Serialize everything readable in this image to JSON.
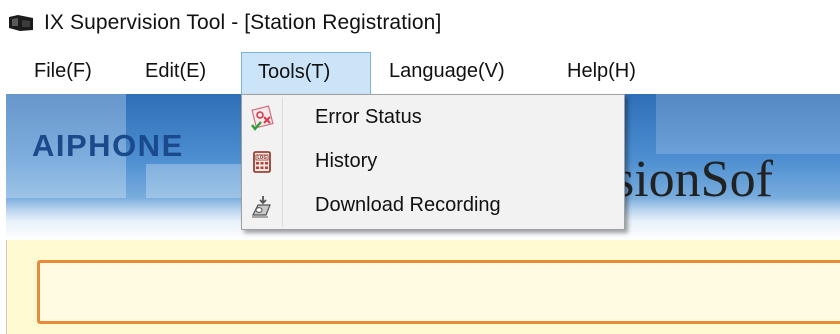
{
  "window": {
    "title": "IX Supervision Tool - [Station Registration]",
    "app_icon": "app-icon"
  },
  "menubar": {
    "items": [
      {
        "label": "File(F)"
      },
      {
        "label": "Edit(E)"
      },
      {
        "label": "Tools(T)",
        "active": true
      },
      {
        "label": "Language(V)"
      },
      {
        "label": "Help(H)"
      }
    ]
  },
  "tools_menu": {
    "items": [
      {
        "label": "Error Status",
        "icon": "error-status-icon"
      },
      {
        "label": "History",
        "icon": "history-log-icon"
      },
      {
        "label": "Download Recording",
        "icon": "download-recording-icon"
      }
    ]
  },
  "banner": {
    "logo": "AIPHONE",
    "product_text": "sionSof"
  },
  "colors": {
    "menu_highlight": "#cce4f7",
    "banner_blue": "#2e6fb8",
    "logo_blue": "#1a4a8c",
    "content_bg": "#fffad2",
    "status_border": "#e78a3a"
  }
}
